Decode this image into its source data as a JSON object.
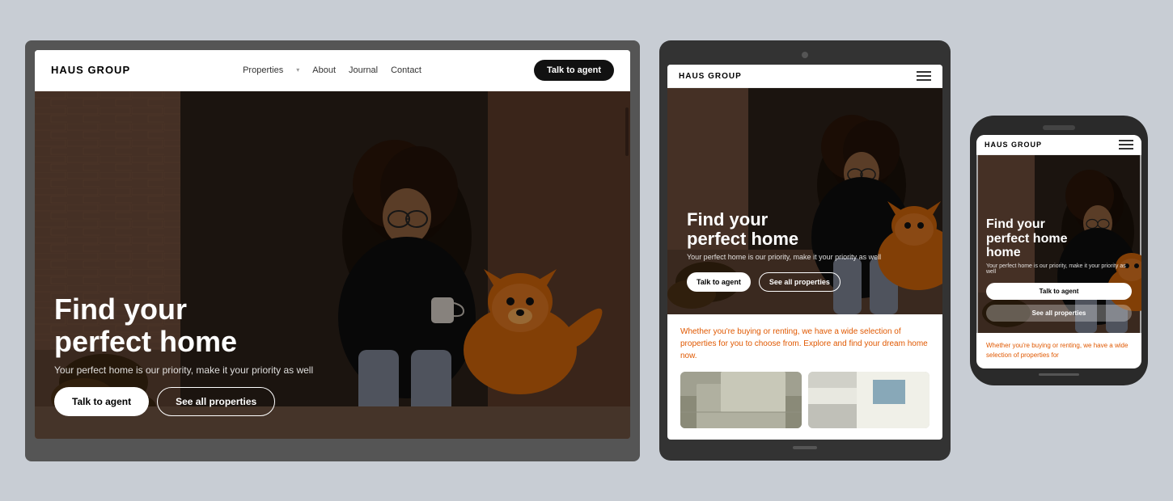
{
  "brand": "HAUS GROUP",
  "nav": {
    "properties_label": "Properties",
    "about_label": "About",
    "journal_label": "Journal",
    "contact_label": "Contact",
    "cta_label": "Talk to agent"
  },
  "hero": {
    "title_line1": "Find your",
    "title_line2": "perfect home",
    "subtitle": "Your perfect home is our priority, make it your priority as well",
    "cta_primary": "Talk to agent",
    "cta_secondary": "See all properties"
  },
  "tablet_description": "Whether you're buying or renting, we have a wide selection of properties for you to choose from. Explore and find your dream home now.",
  "mobile_description": "Whether you're buying or renting, we have a wide selection of properties for",
  "colors": {
    "accent_orange": "#e05800",
    "bg_page": "#c8cdd4",
    "nav_bg": "#ffffff",
    "dark": "#111111",
    "hero_overlay": "rgba(0,0,0,0.35)"
  }
}
